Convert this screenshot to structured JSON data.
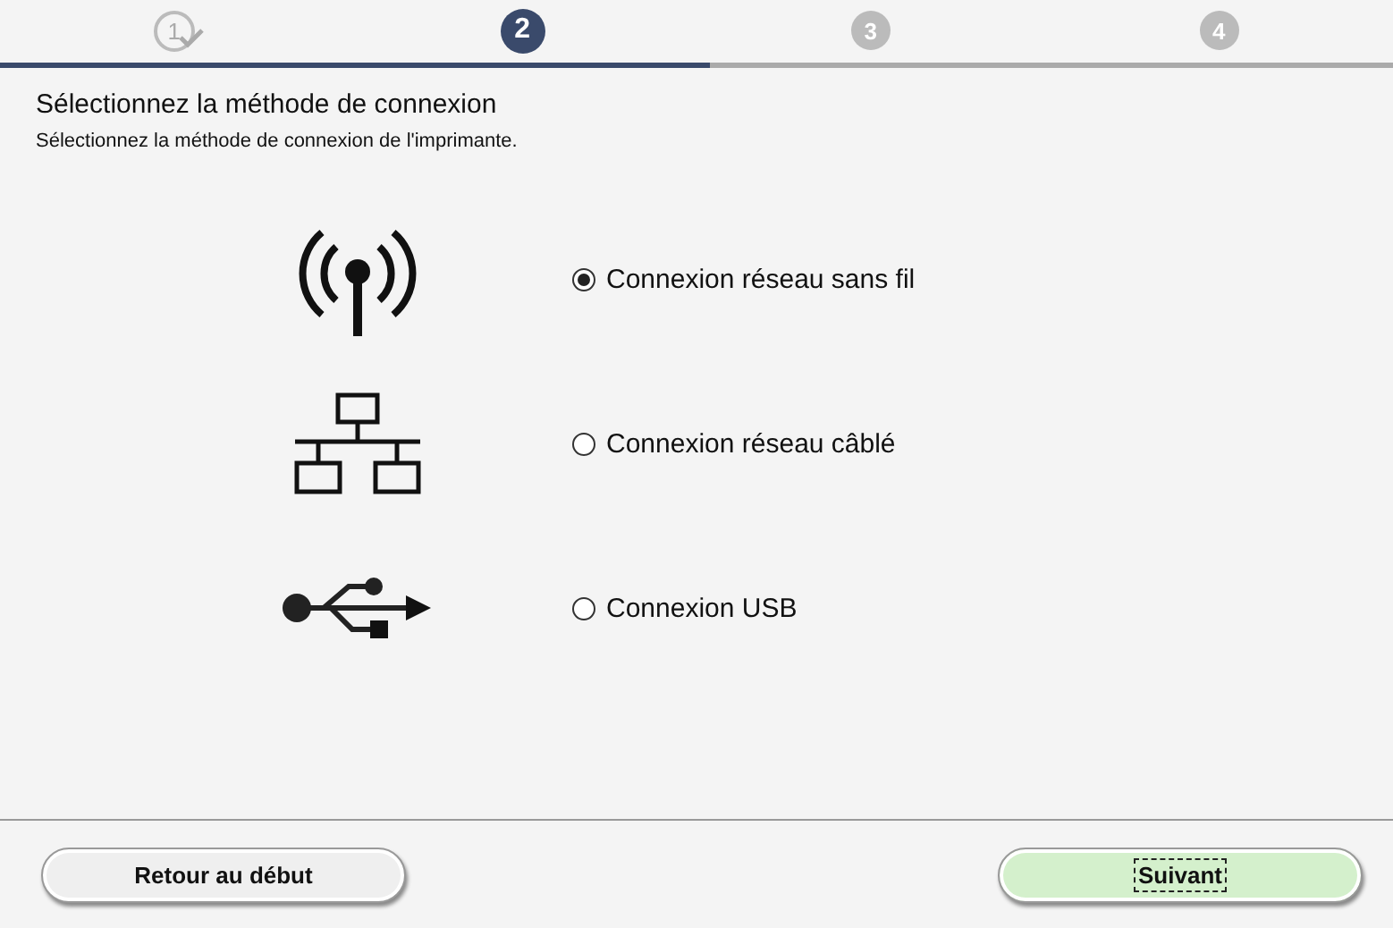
{
  "steps": [
    {
      "number": "1",
      "done": true,
      "selected": false
    },
    {
      "number": "2",
      "done": false,
      "selected": true
    },
    {
      "number": "3",
      "done": false,
      "selected": false
    },
    {
      "number": "4",
      "done": false,
      "selected": false
    }
  ],
  "progress": {
    "level": 0.51
  },
  "title": "Sélectionnez la méthode de connexion",
  "subtitle": "Sélectionnez la méthode de connexion de l'imprimante.",
  "options": [
    {
      "kind": "wireless",
      "label": "Connexion réseau sans fil",
      "selected": true
    },
    {
      "kind": "wired",
      "label": "Connexion réseau câblé",
      "selected": false
    },
    {
      "kind": "usb",
      "label": "Connexion USB",
      "selected": false
    }
  ],
  "buttons": [
    {
      "label": "Retour au début",
      "kind": "back",
      "focused": false
    },
    {
      "label": "Suivant",
      "kind": "next",
      "focused": true
    }
  ]
}
